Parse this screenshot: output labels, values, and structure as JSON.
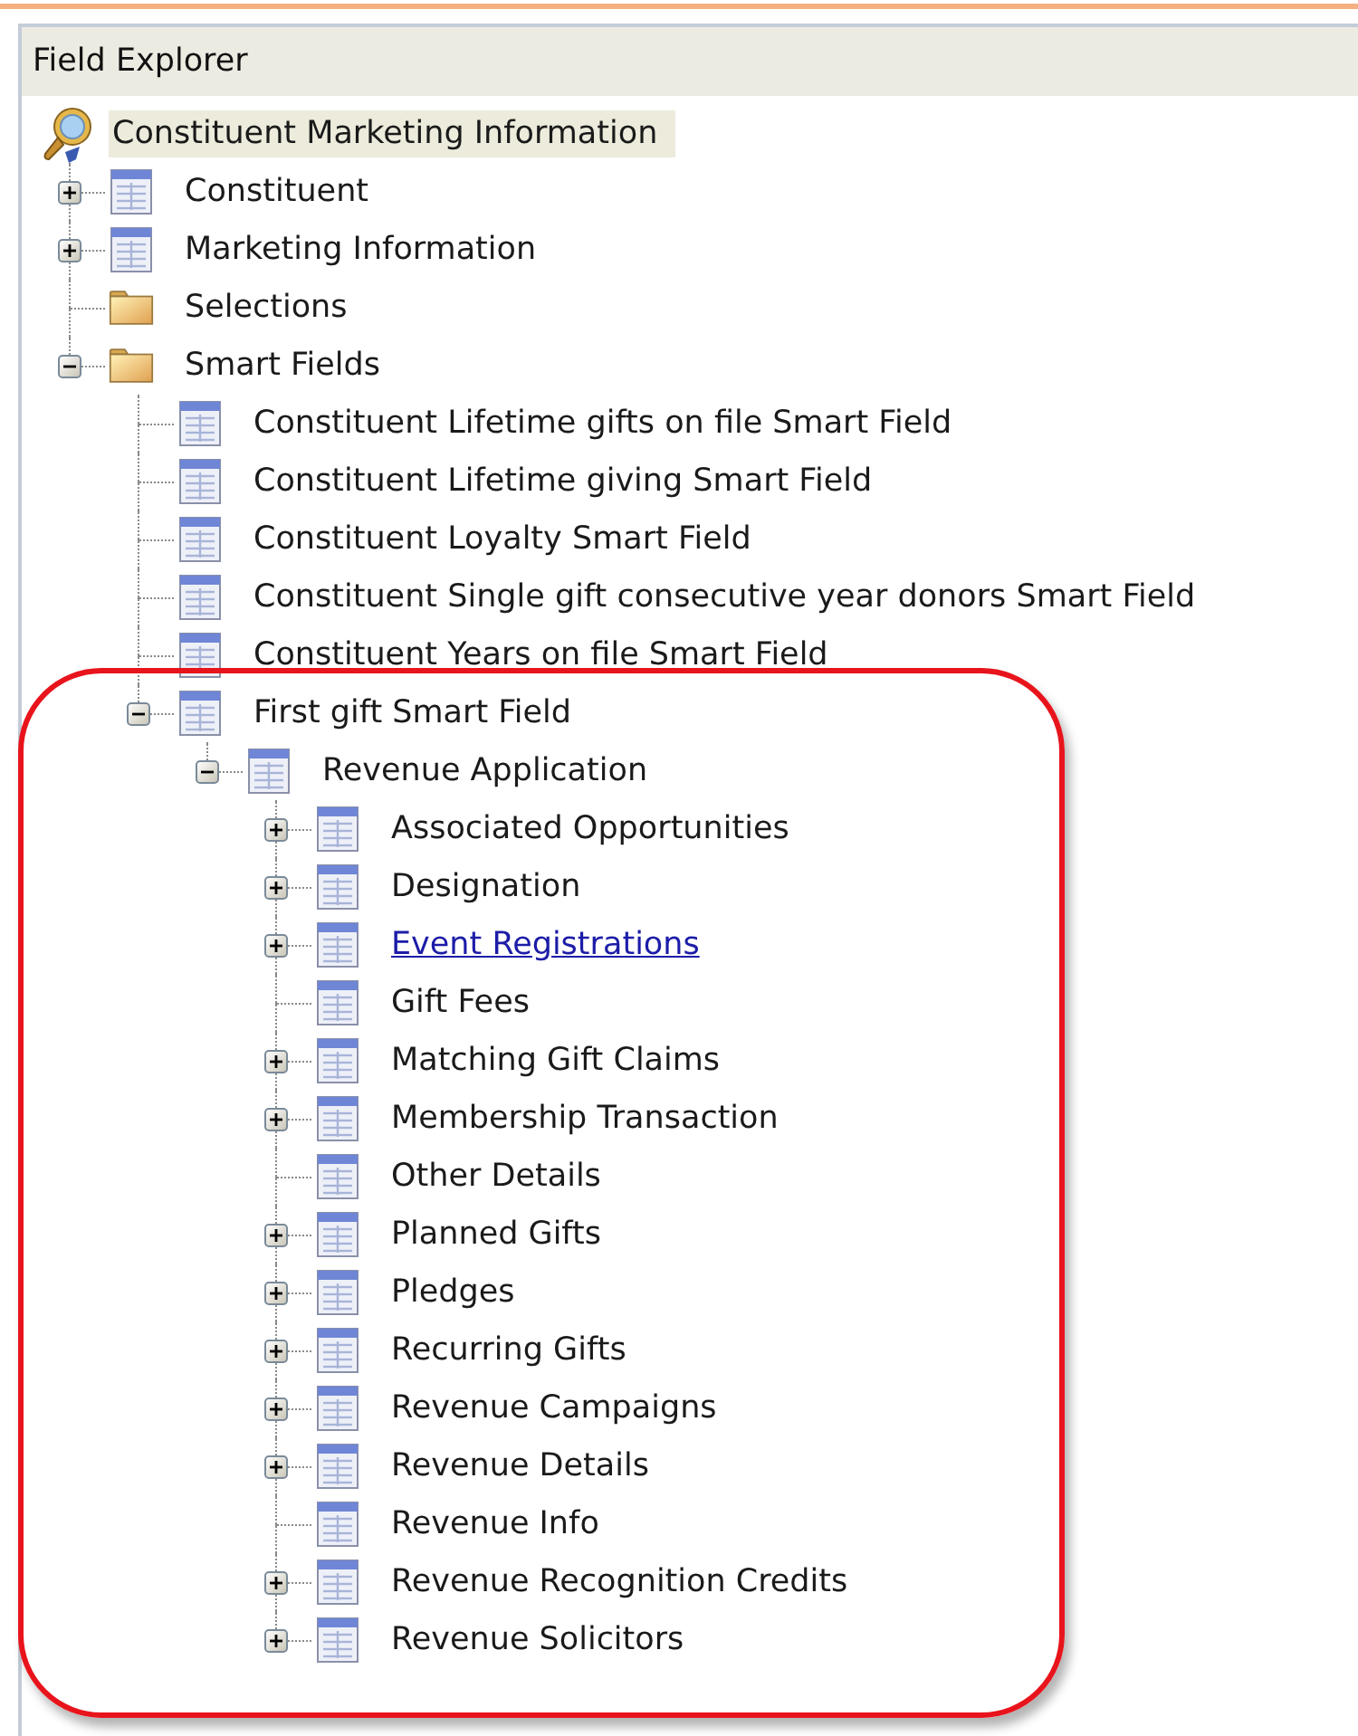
{
  "title": "Field Explorer",
  "tree": [
    {
      "label": "Constituent Marketing Information",
      "kind": "search",
      "selected": true,
      "hot": false,
      "children": [
        {
          "label": "Constituent",
          "kind": "table",
          "selected": false,
          "hot": false,
          "expanded": false
        },
        {
          "label": "Marketing Information",
          "kind": "table",
          "selected": false,
          "hot": false,
          "expanded": false
        },
        {
          "label": "Selections",
          "kind": "folder",
          "selected": false,
          "hot": false
        },
        {
          "label": "Smart Fields",
          "kind": "folder",
          "selected": false,
          "hot": false,
          "expanded": true,
          "children": [
            {
              "label": "Constituent Lifetime gifts on file Smart Field",
              "kind": "table",
              "selected": false,
              "hot": false
            },
            {
              "label": "Constituent Lifetime giving Smart Field",
              "kind": "table",
              "selected": false,
              "hot": false
            },
            {
              "label": "Constituent Loyalty Smart Field",
              "kind": "table",
              "selected": false,
              "hot": false
            },
            {
              "label": "Constituent Single gift consecutive year donors Smart Field",
              "kind": "table",
              "selected": false,
              "hot": false
            },
            {
              "label": "Constituent Years on file Smart Field",
              "kind": "table",
              "selected": false,
              "hot": false
            },
            {
              "label": "First gift Smart Field",
              "kind": "table",
              "selected": false,
              "hot": false,
              "expanded": true,
              "children": [
                {
                  "label": "Revenue Application",
                  "kind": "table",
                  "selected": false,
                  "hot": false,
                  "expanded": true,
                  "children": [
                    {
                      "label": "Associated Opportunities",
                      "kind": "table",
                      "selected": false,
                      "hot": false,
                      "expanded": false
                    },
                    {
                      "label": "Designation",
                      "kind": "table",
                      "selected": false,
                      "hot": false,
                      "expanded": false
                    },
                    {
                      "label": "Event Registrations",
                      "kind": "table",
                      "selected": false,
                      "hot": true,
                      "expanded": false
                    },
                    {
                      "label": "Gift Fees",
                      "kind": "table",
                      "selected": false,
                      "hot": false
                    },
                    {
                      "label": "Matching Gift Claims",
                      "kind": "table",
                      "selected": false,
                      "hot": false,
                      "expanded": false
                    },
                    {
                      "label": "Membership Transaction",
                      "kind": "table",
                      "selected": false,
                      "hot": false,
                      "expanded": false
                    },
                    {
                      "label": "Other Details",
                      "kind": "table",
                      "selected": false,
                      "hot": false
                    },
                    {
                      "label": "Planned Gifts",
                      "kind": "table",
                      "selected": false,
                      "hot": false,
                      "expanded": false
                    },
                    {
                      "label": "Pledges",
                      "kind": "table",
                      "selected": false,
                      "hot": false,
                      "expanded": false
                    },
                    {
                      "label": "Recurring Gifts",
                      "kind": "table",
                      "selected": false,
                      "hot": false,
                      "expanded": false
                    },
                    {
                      "label": "Revenue Campaigns",
                      "kind": "table",
                      "selected": false,
                      "hot": false,
                      "expanded": false
                    },
                    {
                      "label": "Revenue Details",
                      "kind": "table",
                      "selected": false,
                      "hot": false,
                      "expanded": false
                    },
                    {
                      "label": "Revenue Info",
                      "kind": "table",
                      "selected": false,
                      "hot": false
                    },
                    {
                      "label": "Revenue Recognition Credits",
                      "kind": "table",
                      "selected": false,
                      "hot": false,
                      "expanded": false
                    },
                    {
                      "label": "Revenue Solicitors",
                      "kind": "table",
                      "selected": false,
                      "hot": false,
                      "expanded": false
                    }
                  ]
                }
              ]
            }
          ]
        }
      ]
    }
  ]
}
